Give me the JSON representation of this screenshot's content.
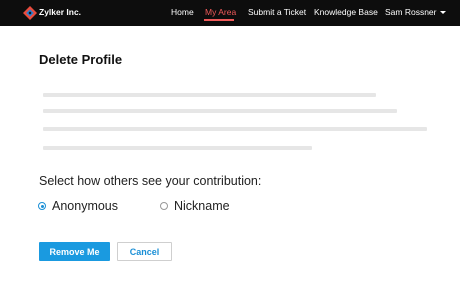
{
  "header": {
    "brand": "Zylker Inc.",
    "nav": [
      {
        "label": "Home",
        "active": false
      },
      {
        "label": "My Area",
        "active": true
      },
      {
        "label": "Submit a Ticket",
        "active": false
      },
      {
        "label": "Knowledge Base",
        "active": false
      }
    ],
    "user_name": "Sam Rossner",
    "user_icon": "chevron-down-icon",
    "accent_color": "#f05a5a"
  },
  "page": {
    "title": "Delete Profile",
    "question": "Select how others see your contribution:",
    "options": [
      {
        "label": "Anonymous",
        "selected": true
      },
      {
        "label": "Nickname",
        "selected": false
      }
    ],
    "primary_button": "Remove Me",
    "secondary_button": "Cancel",
    "button_color": "#1a9ae0"
  }
}
